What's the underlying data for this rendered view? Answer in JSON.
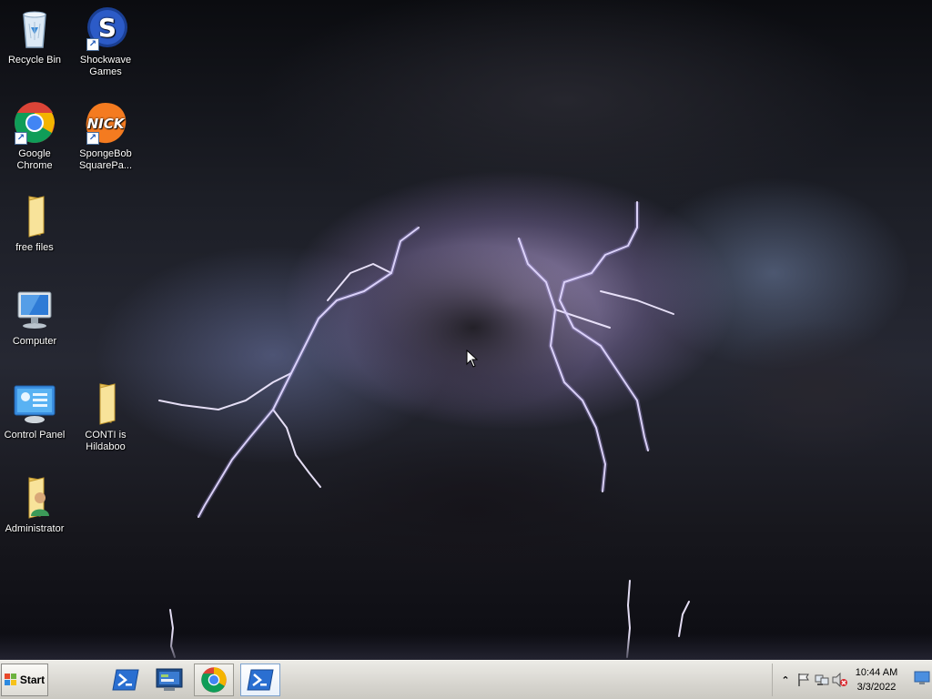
{
  "desktop": {
    "icons": [
      {
        "label": "Recycle Bin",
        "icon": "recycle-bin-icon"
      },
      {
        "label": "Shockwave Games",
        "icon": "shockwave-icon",
        "badge": "S"
      },
      {
        "label": "Google Chrome",
        "icon": "chrome-icon"
      },
      {
        "label": "SpongeBob SquarePa...",
        "icon": "nick-icon",
        "badge": "NICK"
      },
      {
        "label": "free files",
        "icon": "folder-icon"
      },
      {
        "label": "Computer",
        "icon": "computer-icon"
      },
      {
        "label": "Control Panel",
        "icon": "control-panel-icon"
      },
      {
        "label": "CONTI is Hildaboo",
        "icon": "folder-icon"
      },
      {
        "label": "Administrator",
        "icon": "user-folder-icon"
      }
    ]
  },
  "taskbar": {
    "start_label": "Start",
    "buttons": [
      {
        "name": "powershell-taskbar-button",
        "icon": "powershell-icon"
      },
      {
        "name": "server-manager-taskbar-button",
        "icon": "server-manager-icon"
      },
      {
        "name": "chrome-taskbar-button",
        "icon": "chrome-icon"
      },
      {
        "name": "powershell-window-taskbar-button",
        "icon": "powershell-icon"
      }
    ],
    "tray": {
      "time": "10:44 AM",
      "date": "3/3/2022"
    }
  },
  "colors": {
    "taskbar_bg": "#d7d5cf",
    "folder_yellow": "#f2d57a",
    "powershell_blue": "#2a6fd1",
    "lightning": "#e8e0ff"
  }
}
